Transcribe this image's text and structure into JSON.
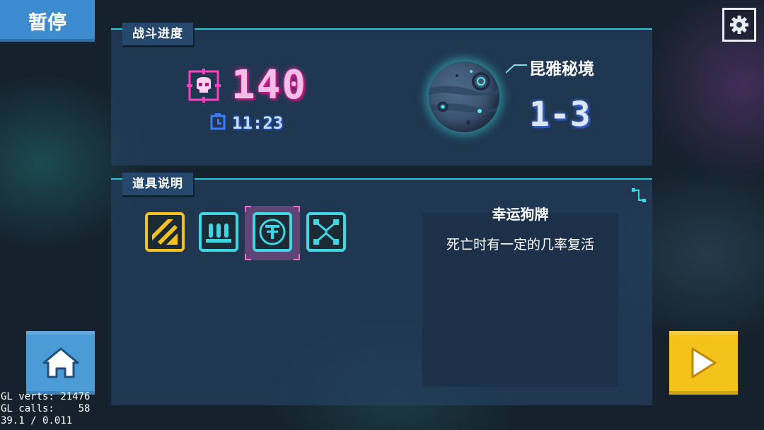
{
  "pause": {
    "label": "暂停"
  },
  "battle": {
    "section_label": "战斗进度",
    "kill_count": "140",
    "time": "11:23",
    "location": "昆雅秘境",
    "stage": "1-3"
  },
  "items": {
    "section_label": "道具说明",
    "selected_title": "幸运狗牌",
    "selected_description": "死亡时有一定的几率复活",
    "slots": [
      {
        "icon": "yellow-arrows-icon"
      },
      {
        "icon": "ammo-icon"
      },
      {
        "icon": "dog-tag-icon",
        "selected": true
      },
      {
        "icon": "network-icon"
      }
    ]
  },
  "debug": {
    "line1": "GL verts: 21476",
    "line2": "GL calls:    58",
    "line3": "39.1 / 0.011"
  },
  "colors": {
    "panel_accent": "#2bc7d6",
    "kill_pink": "#e2279c",
    "play_yellow": "#f3c21b",
    "home_blue": "#4a9bd6"
  }
}
